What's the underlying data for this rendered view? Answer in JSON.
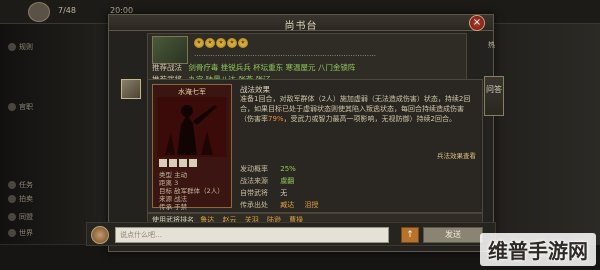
{
  "dialog": {
    "title": "尚书台",
    "close_label": "×"
  },
  "top_block": {
    "star_count": 5,
    "text": "……………………………………………………………………",
    "recommend_label": "推荐战法",
    "recommend_values": "剑骨疗毒  挫锐兵兵  杯坛重东  寒温屋元  八门金锁阵",
    "recommend_generals_label": "推荐武将",
    "recommend_generals_values": "九宫  陆景八达  张燕  张辽"
  },
  "detail": {
    "card_title": "水淹七军",
    "desc_title": "战法效果",
    "description_parts": [
      "准备1回合，对敌军群体（2人）施加虚弱（无法造成伤害）状态，持续2回合，如果目标已处于虚弱状态则使其陷入叛逃状态，每回合持续造成伤害（伤害率",
      "79%",
      "，受武力或智力最高一项影响，无视防御）持续2回合。"
    ],
    "effect_link": "兵法效果查看",
    "card_info": [
      "类型 主动",
      "距离 3",
      "目标 敌军群体（2人）",
      "来源 战法",
      "传承 于禁"
    ],
    "stats": {
      "rate_label": "发动概率",
      "rate_value": "25%",
      "source_label": "战法来源",
      "source_value": "虞翻",
      "own_label": "自带武将",
      "own_value": "无",
      "inherit_label": "传承出处",
      "inherit_values": [
        "臧达",
        "沮授"
      ]
    },
    "users_label": "使用武将排名",
    "users_values": [
      "鲁达",
      "赵云",
      "关羽",
      "陆逊",
      "曹操"
    ]
  },
  "side": {
    "hot_label": "热",
    "tab_label": "问答"
  },
  "background": {
    "resources": [
      "7/48",
      "20:00"
    ],
    "side_items": [
      "规则",
      "官职",
      "任务",
      "拍卖",
      "同盟",
      "世界"
    ]
  },
  "chat": {
    "placeholder": "说点什么吧…",
    "up_label": "↑",
    "send_label": "发送"
  },
  "watermark": "维普手游网",
  "colors": {
    "accent_green": "#8fcc5a",
    "accent_orange": "#e0a040",
    "highlight": "#e98a3a",
    "close_red": "#b23a2a"
  }
}
